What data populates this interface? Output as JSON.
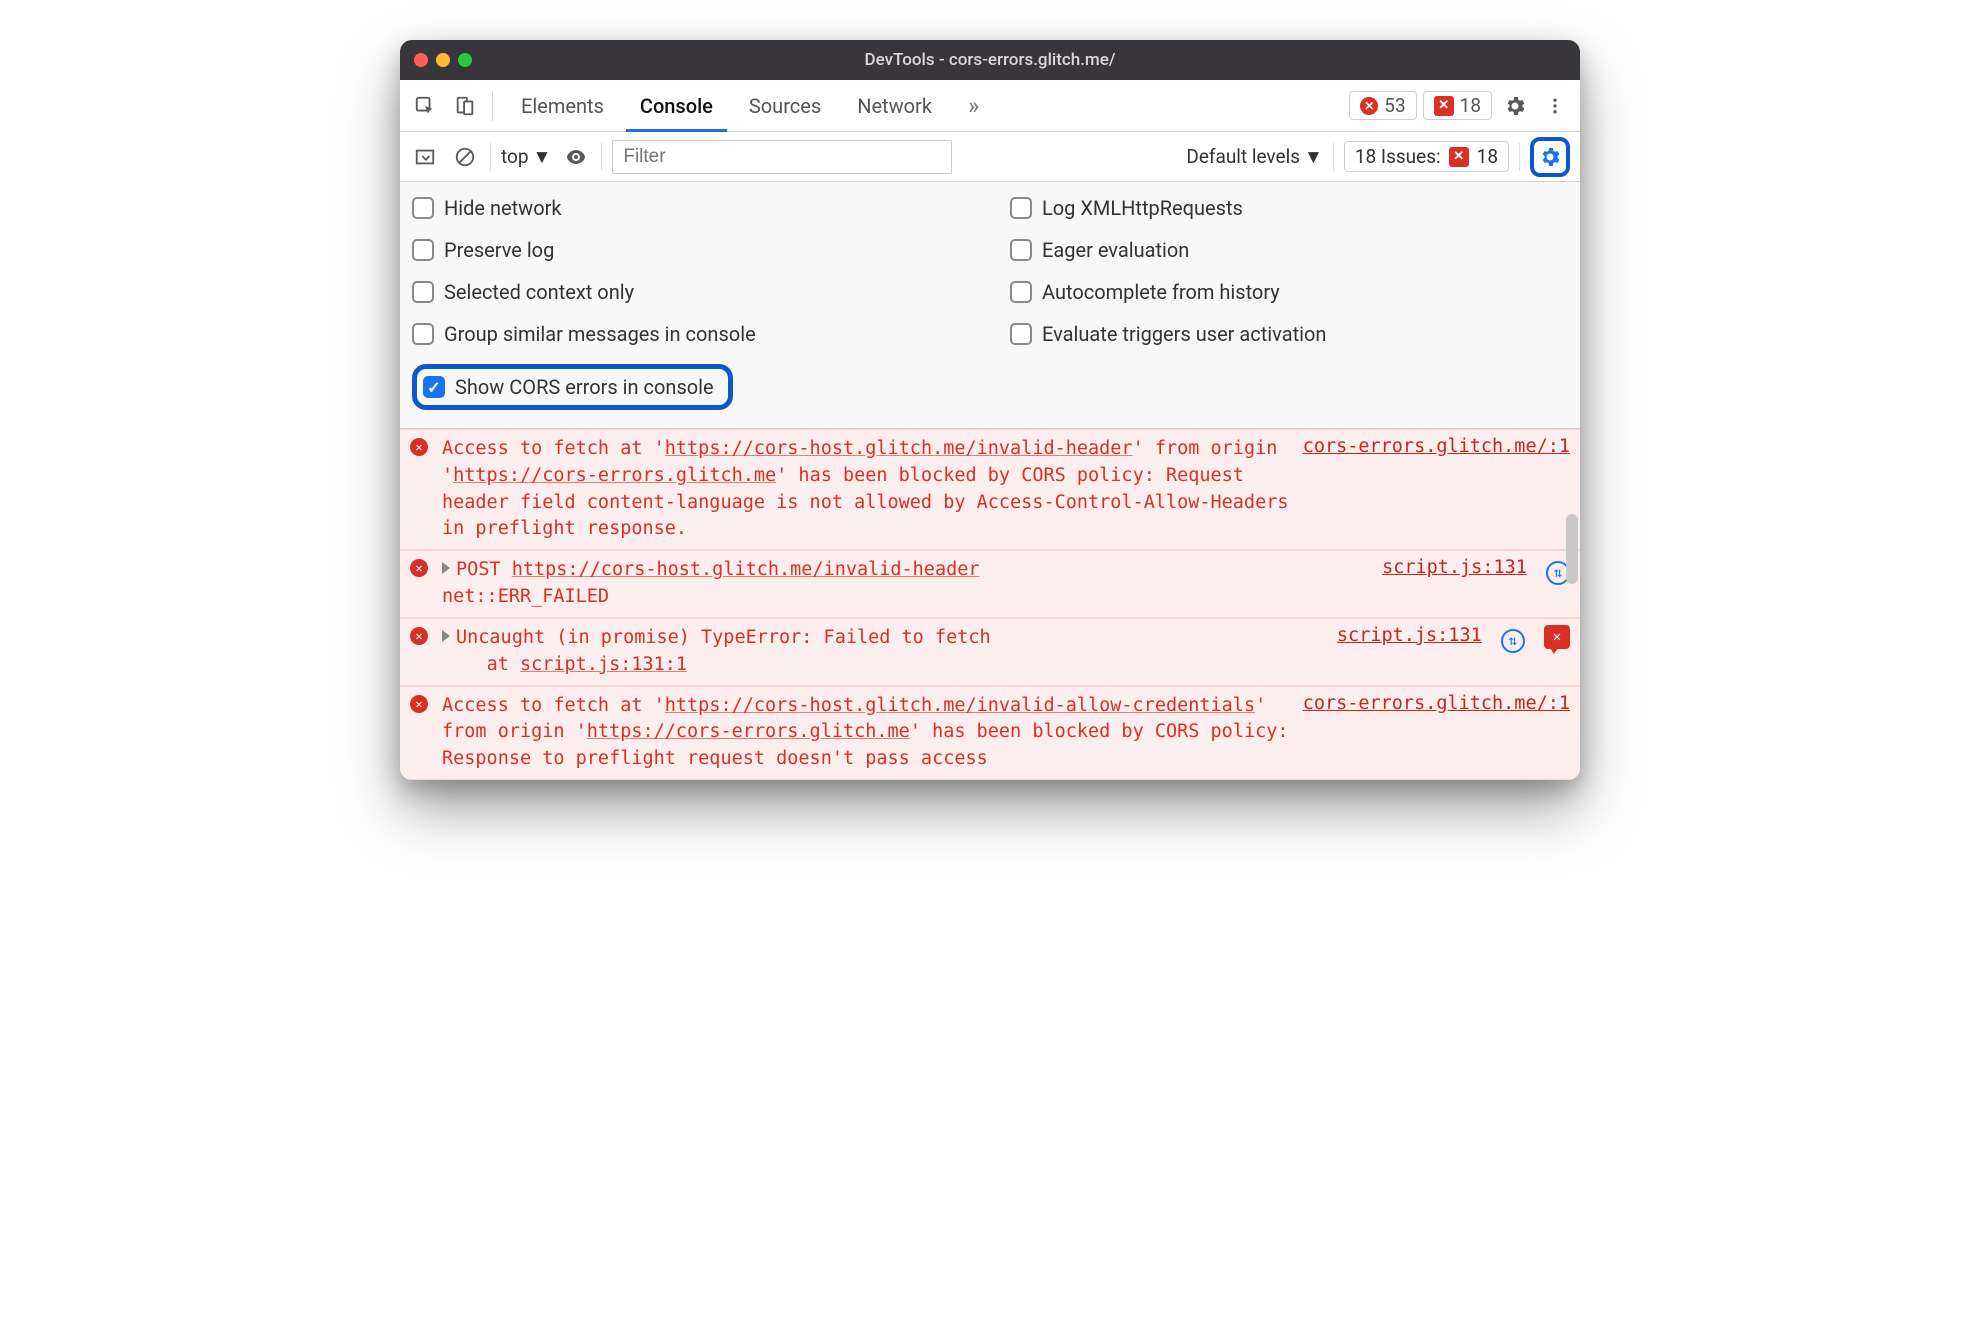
{
  "titlebar": {
    "title": "DevTools - cors-errors.glitch.me/"
  },
  "tabs": {
    "items": [
      {
        "label": "Elements"
      },
      {
        "label": "Console"
      },
      {
        "label": "Sources"
      },
      {
        "label": "Network"
      }
    ],
    "activeIndex": 1
  },
  "toolbar": {
    "errorCount": "53",
    "issueCount": "18"
  },
  "consoleBar": {
    "context": "top",
    "filterPlaceholder": "Filter",
    "levelsLabel": "Default levels",
    "issuesPrefix": "18 Issues:",
    "issuesCount": "18"
  },
  "settings": {
    "left": [
      {
        "label": "Hide network",
        "checked": false
      },
      {
        "label": "Preserve log",
        "checked": false
      },
      {
        "label": "Selected context only",
        "checked": false
      },
      {
        "label": "Group similar messages in console",
        "checked": false
      },
      {
        "label": "Show CORS errors in console",
        "checked": true,
        "highlight": true
      }
    ],
    "right": [
      {
        "label": "Log XMLHttpRequests",
        "checked": false
      },
      {
        "label": "Eager evaluation",
        "checked": false
      },
      {
        "label": "Autocomplete from history",
        "checked": false
      },
      {
        "label": "Evaluate triggers user activation",
        "checked": false
      }
    ]
  },
  "logs": [
    {
      "type": "cors",
      "text_a": "Access to fetch at '",
      "url1": "https://cors-host.glitch.me/invalid-header",
      "text_b": "' from origin '",
      "url2": "https://cors-errors.glitch.me",
      "text_c": "' has been blocked by CORS policy: Request header field content-language is not allowed by Access-Control-Allow-Headers in preflight response.",
      "source": "cors-errors.glitch.me/:1"
    },
    {
      "type": "net",
      "method": "POST",
      "url": "https://cors-host.glitch.me/invalid-header",
      "status": "net::ERR_FAILED",
      "source": "script.js:131"
    },
    {
      "type": "uncaught",
      "line1": "Uncaught (in promise) TypeError: Failed to fetch",
      "line2_prefix": "at ",
      "line2_loc": "script.js:131:1",
      "source": "script.js:131"
    },
    {
      "type": "cors",
      "text_a": "Access to fetch at '",
      "url1": "https://cors-host.glitch.me/invalid-allow-credentials",
      "text_b": "' from origin '",
      "url2": "https://cors-errors.glitch.me",
      "text_c": "' has been blocked by CORS policy: Response to preflight request doesn't pass access",
      "source": "cors-errors.glitch.me/:1"
    }
  ]
}
